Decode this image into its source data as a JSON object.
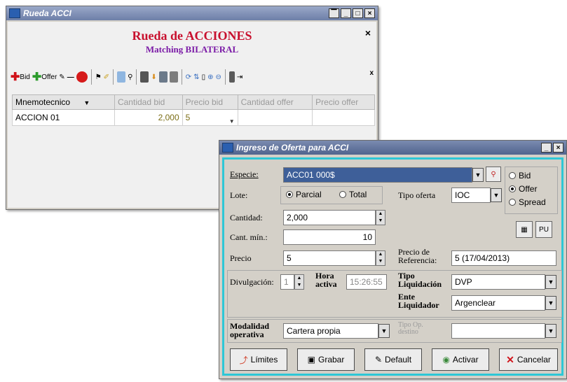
{
  "window1": {
    "title": "Rueda ACCI",
    "heading": "Rueda de ACCIONES",
    "subheading": "Matching BILATERAL",
    "close": "×",
    "toolbar": {
      "bid_label": "Bid",
      "offer_label": "Offer",
      "extra_close": "x"
    },
    "grid": {
      "columns": [
        "Mnemotecnico",
        "Cantidad bid",
        "Precio bid",
        "Cantidad offer",
        "Precio offer"
      ],
      "rows": [
        {
          "mnemotecnico": "ACCION 01",
          "cantidad_bid": "2,000",
          "precio_bid": "5",
          "cantidad_offer": "",
          "precio_offer": ""
        }
      ]
    }
  },
  "window2": {
    "title": "Ingreso de Oferta para ACCI",
    "especie": {
      "label": "Especie:",
      "value": "ACC01    000$"
    },
    "side": {
      "bid": "Bid",
      "offer": "Offer",
      "spread": "Spread",
      "selected": "offer"
    },
    "lote": {
      "label": "Lote:",
      "parcial": "Parcial",
      "total": "Total",
      "selected": "parcial"
    },
    "tipo_oferta": {
      "label": "Tipo oferta",
      "value": "IOC"
    },
    "cantidad": {
      "label": "Cantidad:",
      "value": "2,000"
    },
    "cant_min": {
      "label": "Cant. mín.:",
      "value": "10"
    },
    "precio": {
      "label": "Precio",
      "value": "5"
    },
    "precio_ref": {
      "label_line1": "Precio de",
      "label_line2": "Referencia:",
      "value": "5 (17/04/2013)"
    },
    "divulgacion": {
      "label": "Divulgación:",
      "value": "1"
    },
    "hora": {
      "label_line1": "Hora",
      "label_line2": "activa",
      "value": "15:26:55"
    },
    "tipo_liq": {
      "label_line1": "Tipo",
      "label_line2": "Liquidación",
      "value": "DVP"
    },
    "ente_liq": {
      "label_line1": "Ente",
      "label_line2": "Liquidador",
      "value": "Argenclear"
    },
    "modalidad": {
      "label_line1": "Modalidad",
      "label_line2": "operativa",
      "value": "Cartera propia"
    },
    "tipo_op": {
      "label_line1": "Tipo Op.",
      "label_line2": "destino",
      "value": ""
    },
    "pu_label": "PU",
    "buttons": {
      "limites": "Límites",
      "grabar": "Grabar",
      "default": "Default",
      "activar": "Activar",
      "cancelar": "Cancelar"
    },
    "accent_color": "#2ec7d6"
  }
}
